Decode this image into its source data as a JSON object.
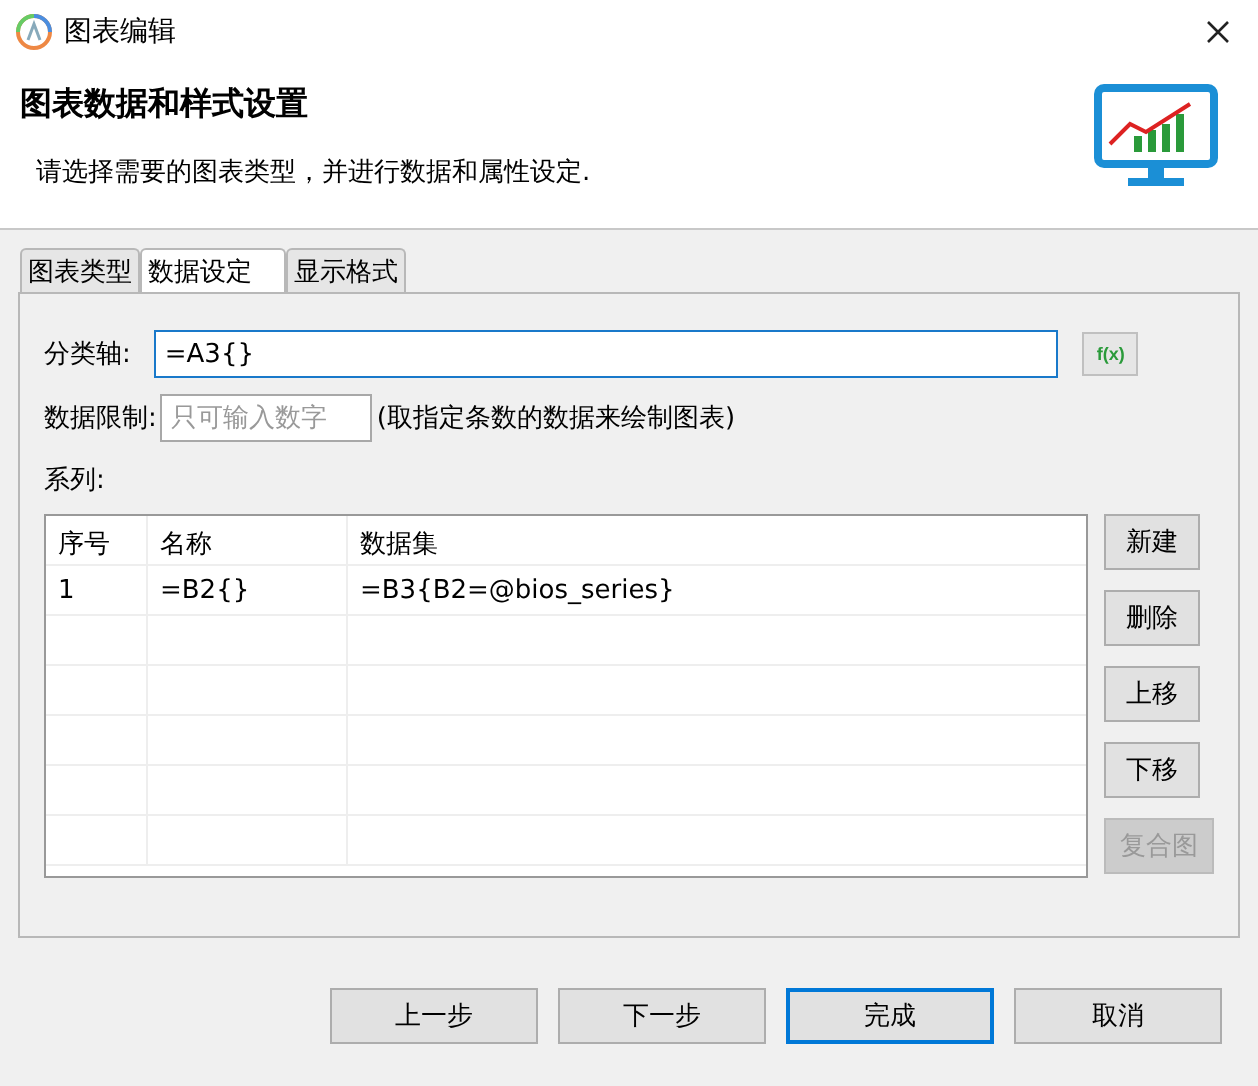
{
  "window": {
    "title": "图表编辑"
  },
  "header": {
    "title": "图表数据和样式设置",
    "subtitle": "请选择需要的图表类型，并进行数据和属性设定."
  },
  "tabs": [
    {
      "label": "图表类型",
      "selected": false
    },
    {
      "label": "数据设定",
      "selected": true
    },
    {
      "label": "显示格式",
      "selected": false
    }
  ],
  "category_axis": {
    "label": "分类轴:",
    "value": "=A3{}",
    "button": "f(x)"
  },
  "data_limit": {
    "label": "数据限制:",
    "placeholder": "只可输入数字",
    "hint": "(取指定条数的数据来绘制图表)"
  },
  "series": {
    "label": "系列:",
    "columns": [
      "序号",
      "名称",
      "数据集"
    ],
    "rows": [
      [
        "1",
        "=B2{}",
        "=B3{B2=@bios_series}"
      ]
    ],
    "buttons": [
      {
        "label": "新建",
        "disabled": false
      },
      {
        "label": "删除",
        "disabled": false
      },
      {
        "label": "上移",
        "disabled": false
      },
      {
        "label": "下移",
        "disabled": false
      },
      {
        "label": "复合图",
        "disabled": true
      }
    ]
  },
  "footer_buttons": [
    {
      "label": "上一步",
      "default": false
    },
    {
      "label": "下一步",
      "default": false
    },
    {
      "label": "完成",
      "default": true
    },
    {
      "label": "取消",
      "default": false
    }
  ]
}
